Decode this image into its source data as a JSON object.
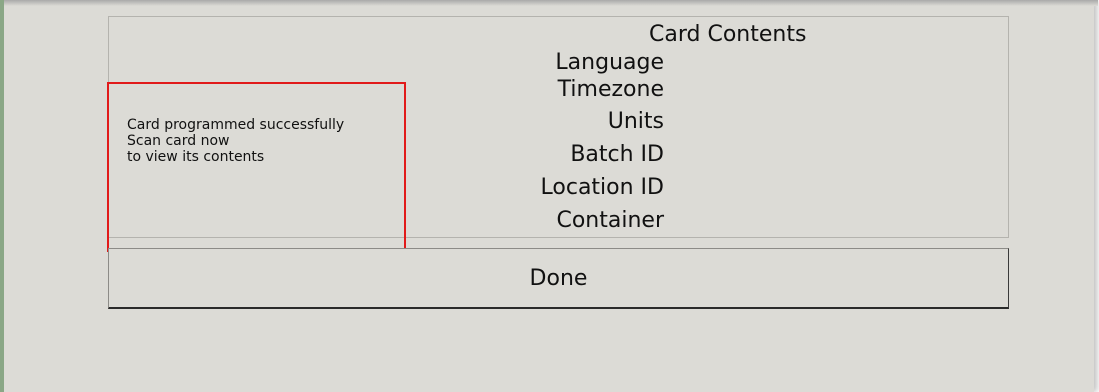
{
  "card_contents": {
    "title": "Card Contents",
    "fields": [
      "Language",
      "Timezone",
      "Units",
      "Batch ID",
      "Location ID",
      "Container"
    ]
  },
  "status": {
    "lines": [
      "Card programmed successfully",
      "Scan card now",
      "to view its contents"
    ]
  },
  "done_button": {
    "label": "Done"
  },
  "colors": {
    "background": "#dcdbd6",
    "highlight": "#e11a1a",
    "window_edge": "#8aa786"
  }
}
